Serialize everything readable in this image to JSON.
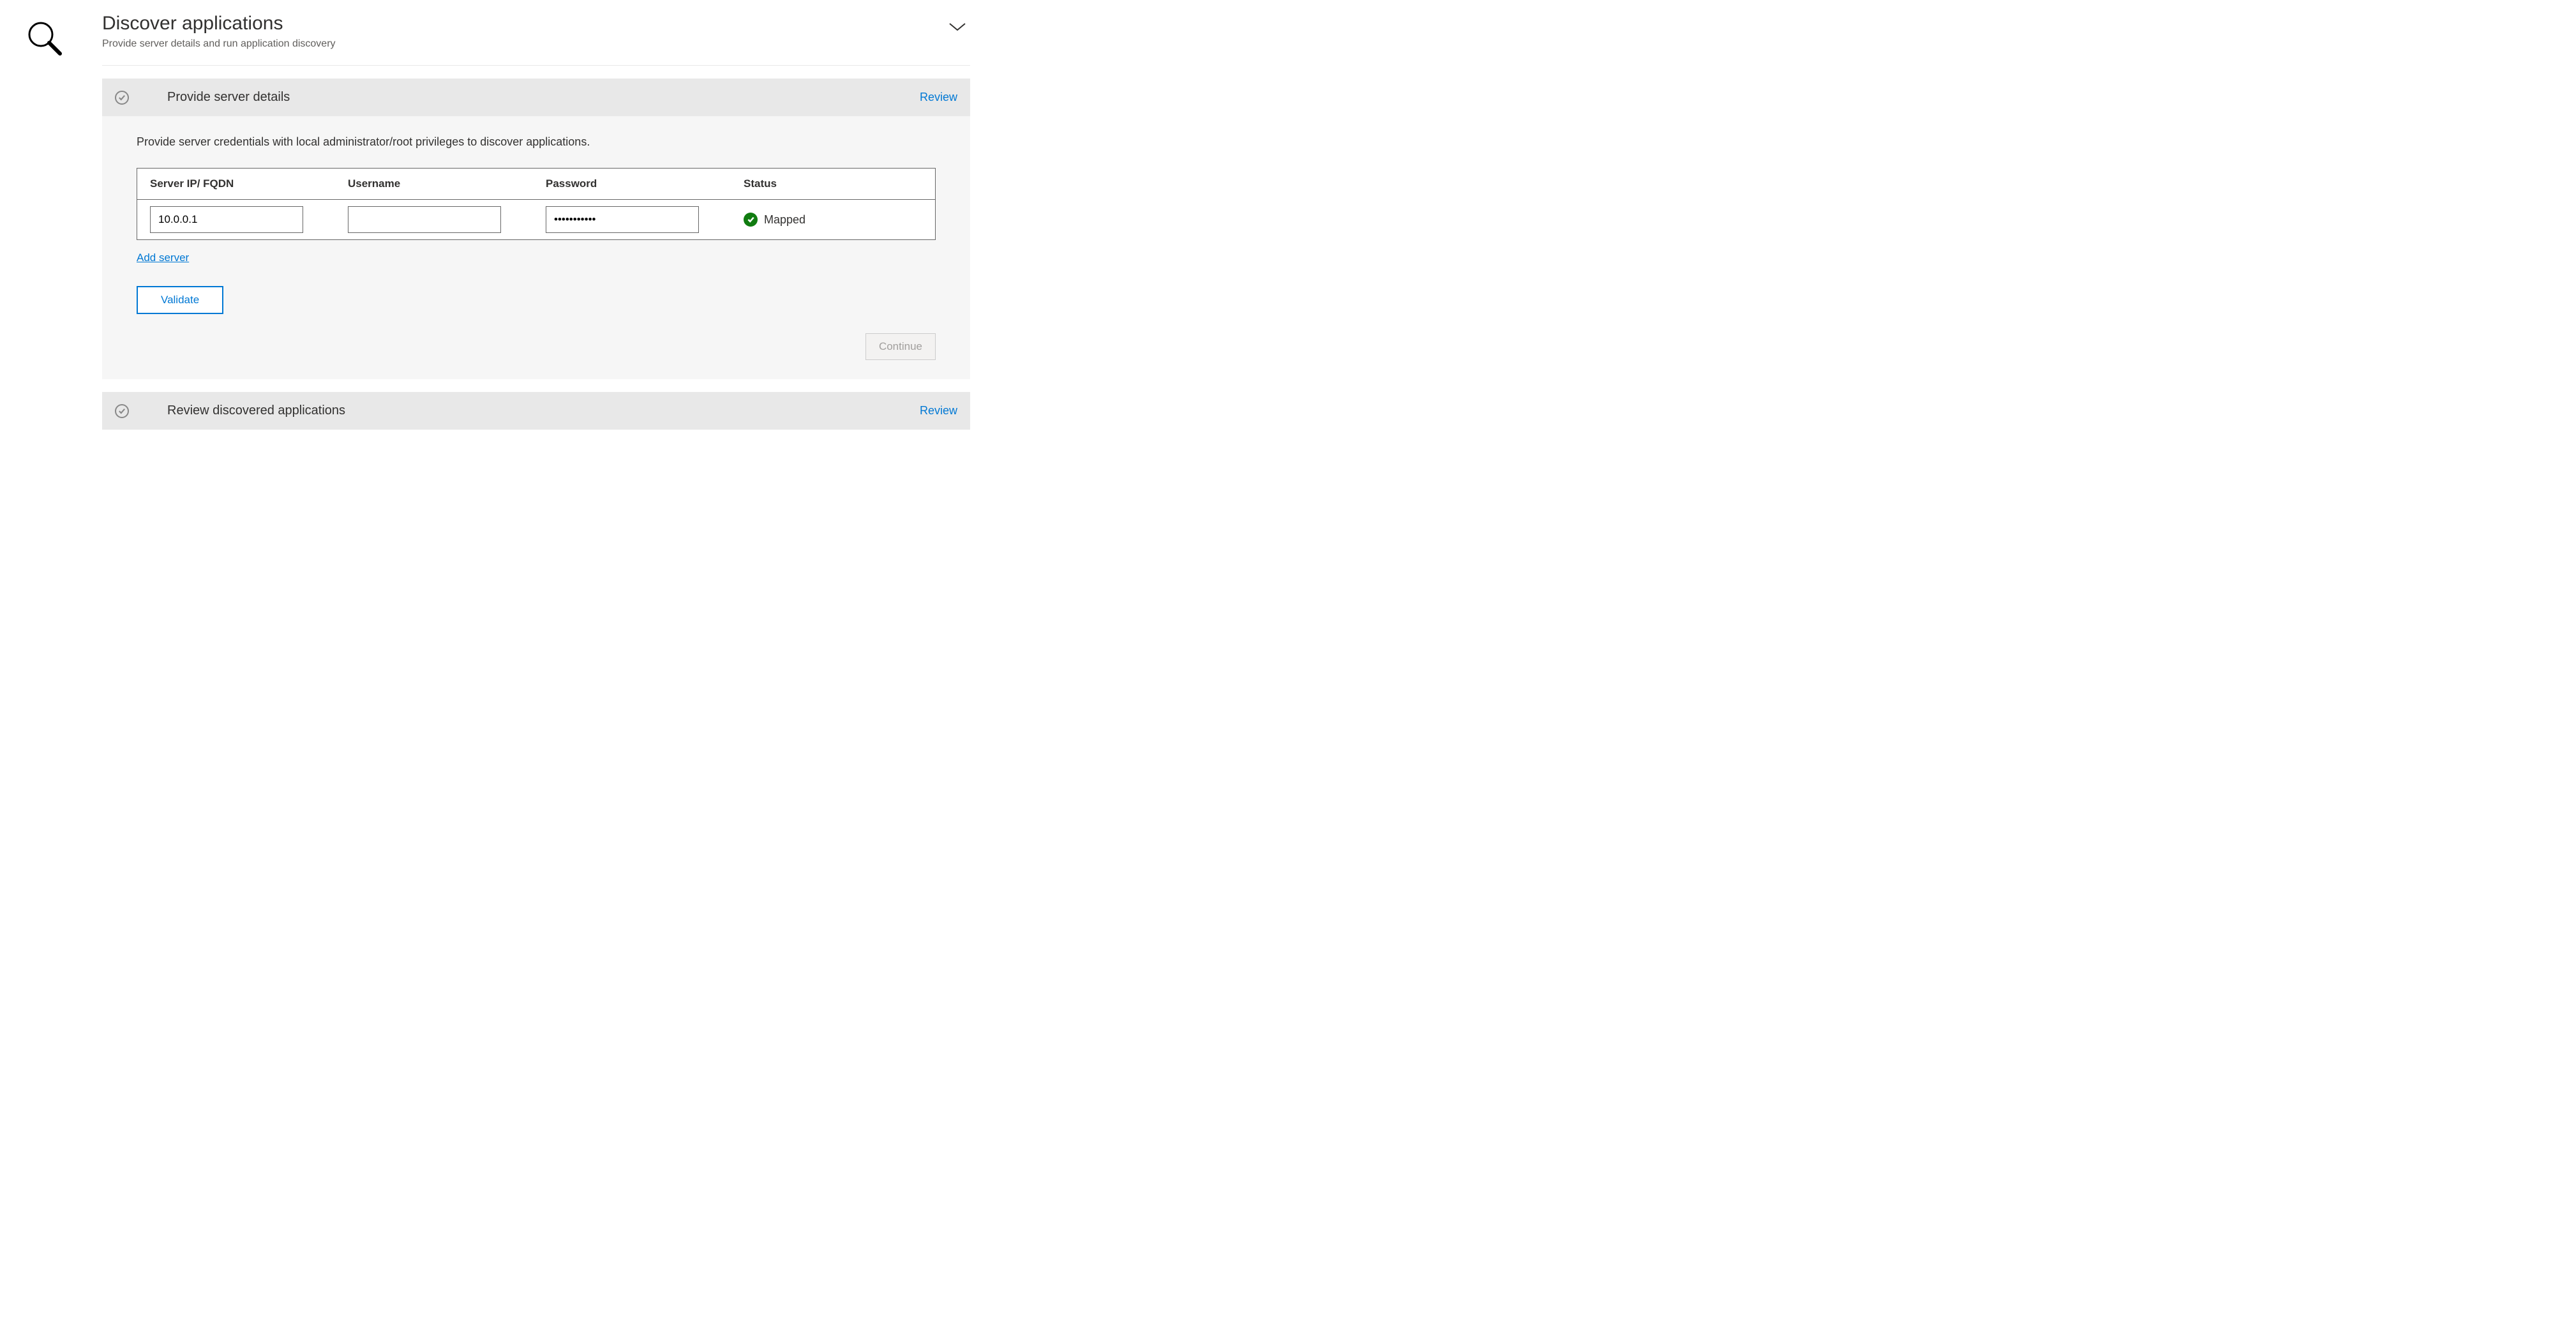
{
  "header": {
    "title": "Discover applications",
    "subtitle": "Provide server details and run application discovery"
  },
  "sections": {
    "provide": {
      "title": "Provide server details",
      "review_label": "Review",
      "description": "Provide server credentials with local administrator/root privileges to discover applications.",
      "columns": {
        "ip": "Server IP/ FQDN",
        "username": "Username",
        "password": "Password",
        "status": "Status"
      },
      "row": {
        "ip_value": "10.0.0.1",
        "username_value": "",
        "password_value": "•••••••••••",
        "status_text": "Mapped"
      },
      "add_server_label": "Add server",
      "validate_label": "Validate",
      "continue_label": "Continue"
    },
    "review": {
      "title": "Review discovered applications",
      "review_label": "Review"
    }
  }
}
